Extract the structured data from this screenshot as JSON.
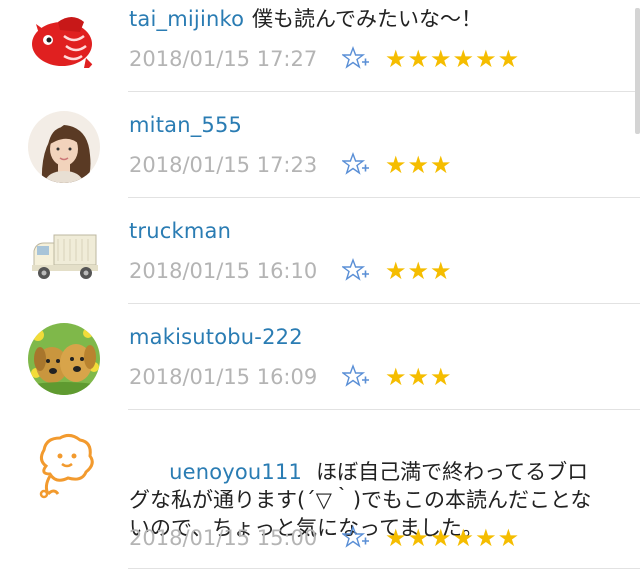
{
  "comments": [
    {
      "username": "tai_mijinko",
      "text": "僕も読んでみたいな～！",
      "timestamp": "2018/01/15 17:27",
      "stars": "★★★★★★",
      "star_count": 6,
      "avatar": "red-fish-avatar"
    },
    {
      "username": "mitan_555",
      "text": "",
      "timestamp": "2018/01/15 17:23",
      "stars": "★★★",
      "star_count": 3,
      "avatar": "woman-portrait-avatar"
    },
    {
      "username": "truckman",
      "text": "",
      "timestamp": "2018/01/15 16:10",
      "stars": "★★★",
      "star_count": 3,
      "avatar": "truck-avatar"
    },
    {
      "username": "makisutobu-222",
      "text": "",
      "timestamp": "2018/01/15 16:09",
      "stars": "★★★",
      "star_count": 3,
      "avatar": "dogs-avatar"
    },
    {
      "username": "uenoyou111",
      "text": "ほぼ自己満で終わってるブログな私が通ります(´▽｀)でもこの本読んだことないので、ちょっと気になってました。",
      "timestamp": "2018/01/15 15:00",
      "stars": "★★★★★★",
      "star_count": 6,
      "avatar": "orange-character-avatar"
    }
  ],
  "colors": {
    "username": "#2a7cb3",
    "timestamp": "#b4b4b4",
    "star": "#f5bd00",
    "add_star": "#5a8fd6"
  },
  "icons": {
    "add_star": "add-star-icon"
  }
}
